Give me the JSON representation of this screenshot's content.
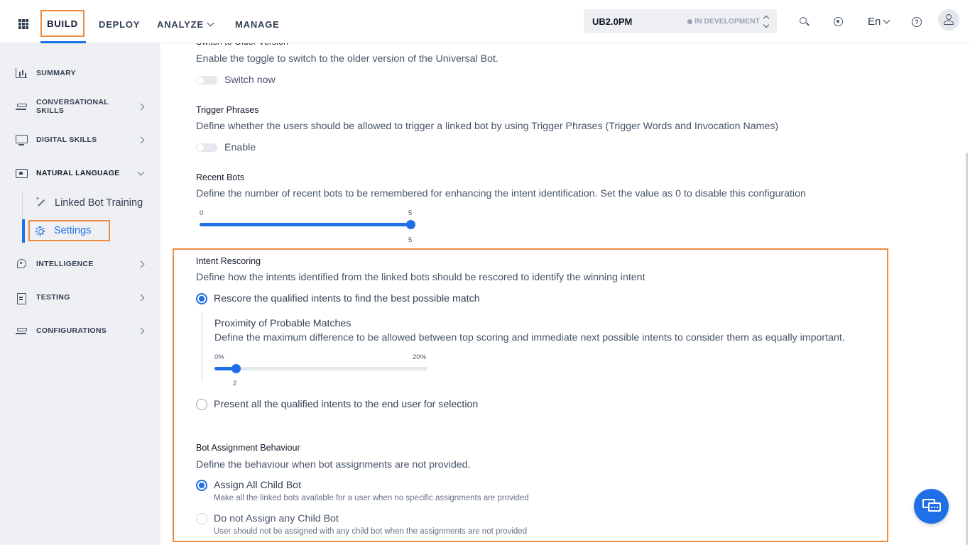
{
  "topbar": {
    "nav": {
      "build": "BUILD",
      "deploy": "DEPLOY",
      "analyze": "ANALYZE",
      "manage": "MANAGE"
    },
    "bot_selector": {
      "name": "UB2.0PM",
      "status": "IN DEVELOPMENT"
    },
    "language": "En",
    "help_glyph": "?"
  },
  "sidebar": {
    "items": [
      {
        "label": "SUMMARY",
        "icon": "bar-chart-icon"
      },
      {
        "label": "CONVERSATIONAL SKILLS",
        "icon": "stack-icon"
      },
      {
        "label": "DIGITAL SKILLS",
        "icon": "monitor-icon"
      },
      {
        "label": "NATURAL LANGUAGE",
        "icon": "natural-language-icon"
      },
      {
        "label": "INTELLIGENCE",
        "icon": "brain-icon"
      },
      {
        "label": "TESTING",
        "icon": "clipboard-icon"
      },
      {
        "label": "CONFIGURATIONS",
        "icon": "stack-icon"
      }
    ],
    "sub_items": [
      {
        "label": "Linked Bot Training",
        "icon": "wand-icon"
      },
      {
        "label": "Settings",
        "icon": "gear-icon"
      }
    ]
  },
  "main": {
    "older_version": {
      "title": "Switch to Older Version",
      "description": "Enable the toggle to switch to the older version of the Universal Bot.",
      "toggle_label": "Switch now",
      "toggle_on": false
    },
    "trigger_phrases": {
      "title": "Trigger Phrases",
      "description": "Define whether the users should be allowed to trigger a linked bot by using Trigger Phrases (Trigger Words and Invocation Names)",
      "toggle_label": "Enable",
      "toggle_on": false
    },
    "recent_bots": {
      "title": "Recent Bots",
      "description": "Define the number of recent bots to be remembered for enhancing the intent identification. Set the value as 0 to disable this configuration",
      "min_label": "0",
      "max_label": "5",
      "value_label": "5",
      "min": 0,
      "max": 5,
      "value": 5
    },
    "intent_rescoring": {
      "title": "Intent Rescoring",
      "description": "Define how the intents identified from the linked bots should be rescored to identify the winning intent",
      "option_rescore": "Rescore the qualified intents to find the best possible match",
      "option_rescore_selected": true,
      "proximity": {
        "title": "Proximity of Probable Matches",
        "description": "Define the maximum difference to be allowed between top scoring and immediate next possible intents to consider them as equally important.",
        "min_label": "0%",
        "max_label": "20%",
        "value_label": "2",
        "min": 0,
        "max": 20,
        "value": 2
      },
      "option_present": "Present all the qualified intents to the end user for selection",
      "option_present_selected": false
    },
    "bot_assignment": {
      "title": "Bot Assignment Behaviour",
      "description": "Define the behaviour when bot assignments are not provided.",
      "option_assign_all": "Assign All Child Bot",
      "option_assign_all_sub": "Make all the linked bots available for a user when no specific assignments are provided",
      "option_assign_all_selected": true,
      "option_none": "Do not Assign any Child Bot",
      "option_none_sub": "User should not be assigned with any child bot when the assignments are not provided",
      "option_none_selected": false
    }
  },
  "colors": {
    "accent": "#1f6fe6",
    "highlight": "#f08a3c",
    "sidebar_bg": "#eef0f3"
  }
}
